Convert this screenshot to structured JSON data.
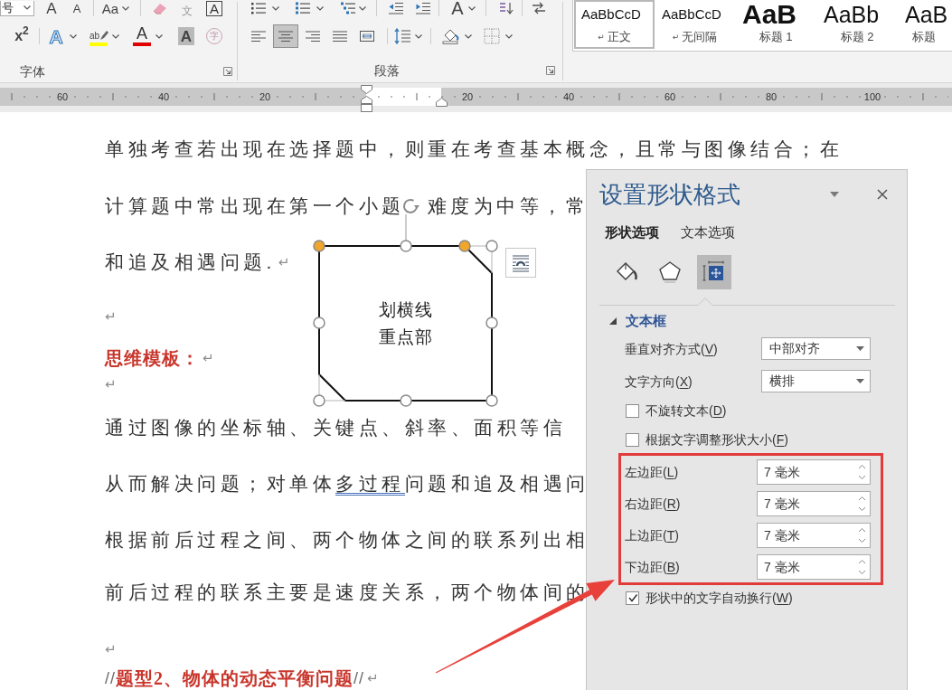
{
  "ribbon": {
    "font_size_value": "号",
    "font_buttons_top": [
      {
        "kind": "grow",
        "text": "A"
      },
      {
        "kind": "shrink",
        "text": "A"
      },
      {
        "kind": "case",
        "text": "Aa"
      },
      {
        "kind": "phonetic",
        "text": "文"
      },
      {
        "kind": "border",
        "text": "A"
      }
    ],
    "font_buttons_bottom": [
      {
        "kind": "superscript",
        "text": "x$^{2}$"
      },
      {
        "kind": "effects",
        "text": "A"
      },
      {
        "kind": "highlight",
        "text": "ab"
      },
      {
        "kind": "font-color",
        "text": "A"
      },
      {
        "kind": "shading",
        "text": "A"
      },
      {
        "kind": "enclose",
        "text": "字"
      }
    ],
    "font_label": "字体",
    "asian_layout_text": "A",
    "alignment": [
      {
        "kind": "left",
        "selected": false
      },
      {
        "kind": "center",
        "selected": true
      },
      {
        "kind": "right",
        "selected": false
      },
      {
        "kind": "justify",
        "selected": false
      },
      {
        "kind": "distributed",
        "selected": false
      }
    ],
    "paragraph_label": "段落",
    "styles": [
      {
        "kind": "body",
        "preview": "AaBbCcD",
        "mark": "↵",
        "label": "正文",
        "selected": true
      },
      {
        "kind": "body",
        "preview": "AaBbCcD",
        "mark": "↵",
        "label": "无间隔",
        "selected": false
      },
      {
        "kind": "heading1",
        "preview": "AaB",
        "label": "标题 1",
        "selected": false
      },
      {
        "kind": "heading2",
        "preview": "AaBb",
        "label": "标题 2",
        "selected": false
      },
      {
        "kind": "title",
        "preview": "AaB",
        "label": "标题",
        "selected": false
      }
    ]
  },
  "ruler": {
    "left_numbers": [
      "60",
      "40",
      "20"
    ],
    "right_numbers": [
      "20",
      "40",
      "60",
      "80",
      "100"
    ]
  },
  "document": {
    "lines": [
      {
        "parts": [
          {
            "kind": "body",
            "text": "单独考查若出现在选择题中，则重在考查基本概念，且常与图像结合；在"
          }
        ]
      },
      {
        "parts": [
          {
            "kind": "body",
            "text": "计算题中常出现在第一个小题"
          },
          {
            "kind": "body",
            "text": "难度为中等，常"
          }
        ]
      },
      {
        "parts": [
          {
            "kind": "body",
            "text": "和追及相遇问题."
          },
          {
            "kind": "mark",
            "text": "↵"
          }
        ]
      },
      {
        "parts": [
          {
            "kind": "mark",
            "text": "↵"
          }
        ]
      },
      {
        "parts": [
          {
            "kind": "heading",
            "text": "思维模板："
          },
          {
            "kind": "mark",
            "text": "↵"
          }
        ]
      },
      {
        "parts": [
          {
            "kind": "mark",
            "text": "↵"
          }
        ]
      },
      {
        "parts": [
          {
            "kind": "body",
            "text": "通过图像的坐标轴、关键点、斜率、面积等信"
          }
        ]
      },
      {
        "parts": [
          {
            "kind": "body",
            "runs": [
              {
                "text": "从而解决问题；对单体",
                "flagged": false
              },
              {
                "text": "多过程",
                "flagged": true
              },
              {
                "text": "问题和追及相遇问",
                "flagged": false
              }
            ]
          }
        ]
      },
      {
        "parts": [
          {
            "kind": "body",
            "text": "根据前后过程之间、两个物体之间的联系列出相"
          }
        ]
      },
      {
        "parts": [
          {
            "kind": "body",
            "text": "前后过程的联系主要是速度关系，两个物体间的"
          }
        ]
      },
      {
        "parts": [
          {
            "kind": "mark",
            "text": "↵"
          }
        ]
      },
      {
        "parts": [
          {
            "kind": "muted",
            "text": "//"
          },
          {
            "kind": "heading",
            "text": "题型2、物体的动态平衡问题"
          },
          {
            "kind": "muted",
            "text": "//"
          },
          {
            "kind": "mark",
            "text": "↵"
          }
        ]
      }
    ]
  },
  "shape": {
    "text": "划横线重点部",
    "selected": true
  },
  "pane": {
    "title": "设置形状格式",
    "tabs": [
      {
        "label": "形状选项",
        "selected": true
      },
      {
        "label": "文本选项",
        "selected": false
      }
    ],
    "categories": [
      {
        "kind": "fill",
        "selected": false
      },
      {
        "kind": "effects",
        "selected": false
      },
      {
        "kind": "layout",
        "selected": true
      }
    ],
    "section": {
      "title": "文本框",
      "expanded": true
    },
    "rows": [
      {
        "kind": "dropdown",
        "label": [
          "垂直对齐方式(",
          "V",
          ")"
        ],
        "value": "中部对齐",
        "highlighted": false
      },
      {
        "kind": "dropdown",
        "label": [
          "文字方向(",
          "X",
          ")"
        ],
        "value": "横排",
        "highlighted": false
      },
      {
        "kind": "checkbox",
        "label": [
          "不旋转文本(",
          "D",
          ")"
        ],
        "checked": false,
        "highlighted": false
      },
      {
        "kind": "checkbox",
        "label": [
          "根据文字调整形状大小(",
          "F",
          ")"
        ],
        "checked": false,
        "highlighted": false
      },
      {
        "kind": "spinner",
        "label": [
          "左边距(",
          "L",
          ")"
        ],
        "value": "7 毫米",
        "highlighted": true
      },
      {
        "kind": "spinner",
        "label": [
          "右边距(",
          "R",
          ")"
        ],
        "value": "7 毫米",
        "highlighted": true
      },
      {
        "kind": "spinner",
        "label": [
          "上边距(",
          "T",
          ")"
        ],
        "value": "7 毫米",
        "highlighted": true
      },
      {
        "kind": "spinner",
        "label": [
          "下边距(",
          "B",
          ")"
        ],
        "value": "7 毫米",
        "highlighted": true
      },
      {
        "kind": "checkbox",
        "label": [
          "形状中的文字自动换行(",
          "W",
          ")"
        ],
        "checked": true,
        "highlighted": false
      }
    ]
  },
  "annotations": [
    {
      "kind": "arrow"
    }
  ]
}
